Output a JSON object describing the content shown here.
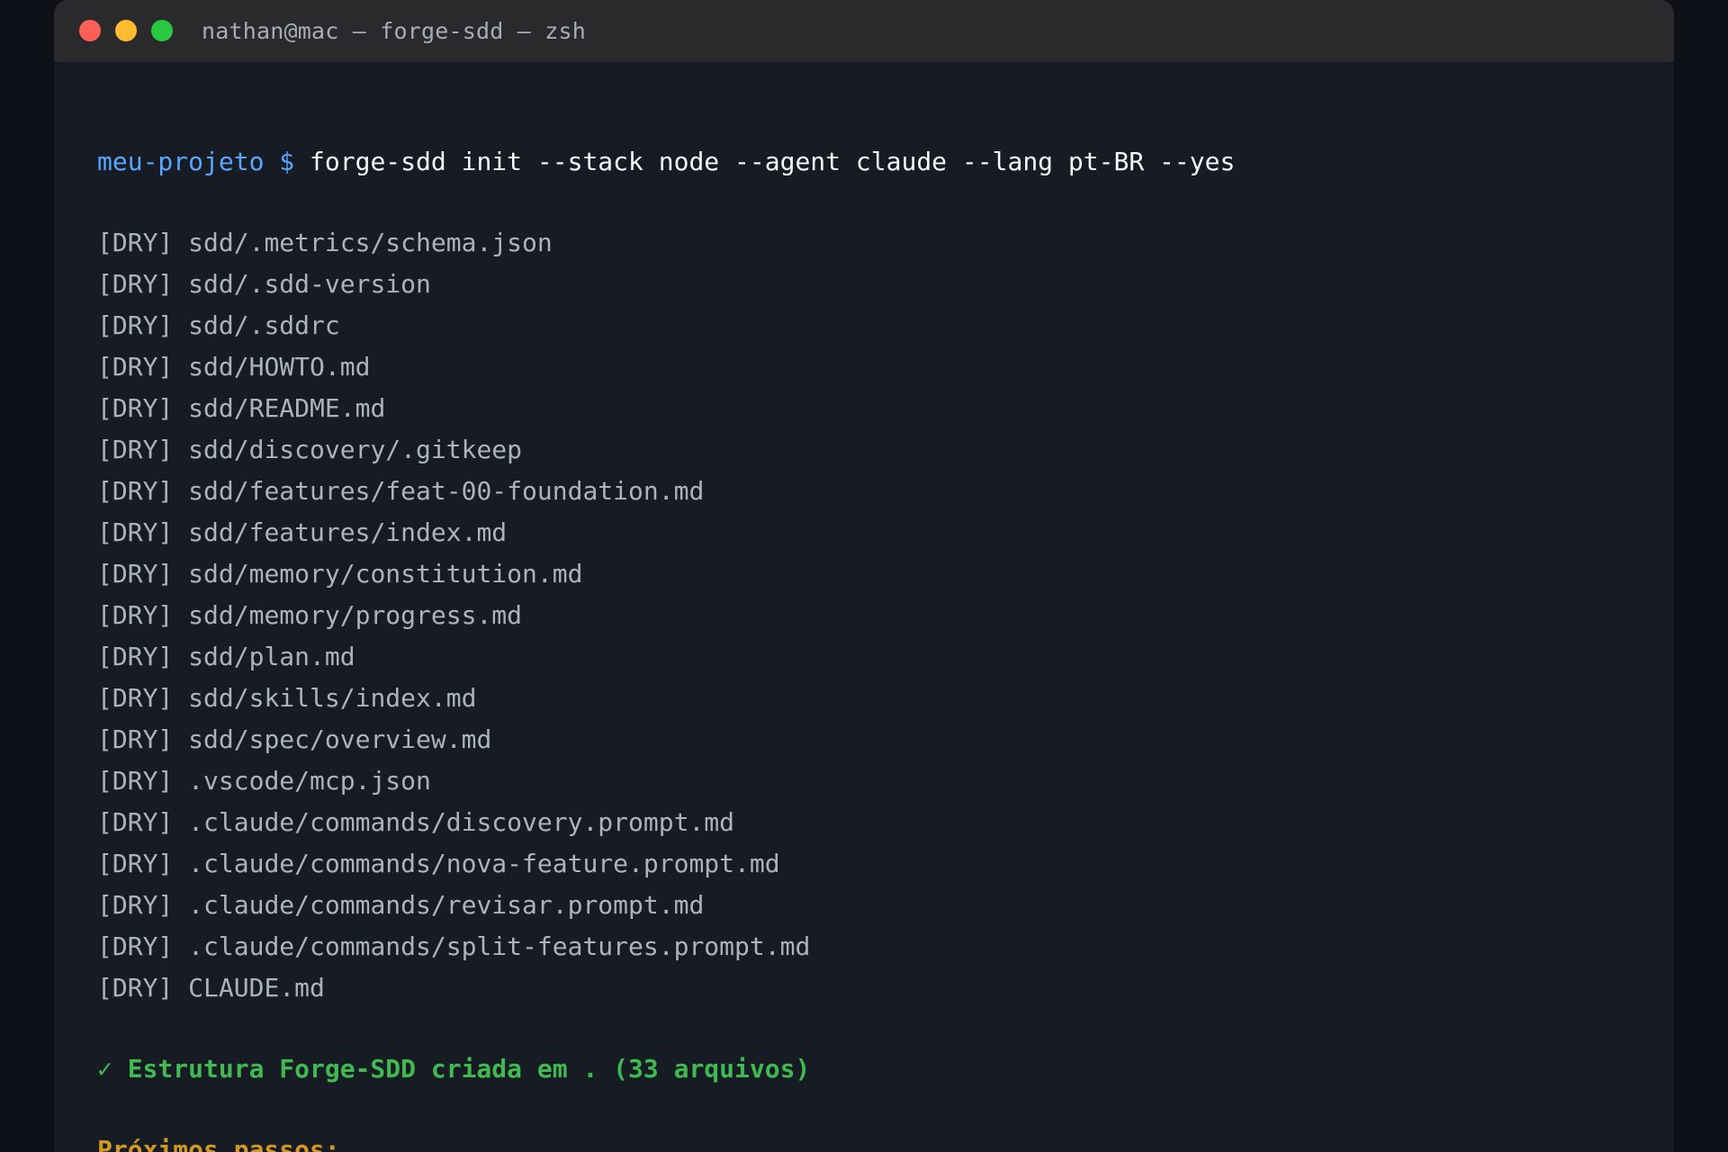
{
  "window": {
    "title": "nathan@mac — forge-sdd — zsh"
  },
  "prompt": {
    "directory": "meu-projeto",
    "symbol": "$",
    "command": "forge-sdd init --stack node --agent claude --lang pt-BR --yes"
  },
  "output": {
    "tag": "[DRY]",
    "files": [
      "sdd/.metrics/schema.json",
      "sdd/.sdd-version",
      "sdd/.sddrc",
      "sdd/HOWTO.md",
      "sdd/README.md",
      "sdd/discovery/.gitkeep",
      "sdd/features/feat-00-foundation.md",
      "sdd/features/index.md",
      "sdd/memory/constitution.md",
      "sdd/memory/progress.md",
      "sdd/plan.md",
      "sdd/skills/index.md",
      "sdd/spec/overview.md",
      ".vscode/mcp.json",
      ".claude/commands/discovery.prompt.md",
      ".claude/commands/nova-feature.prompt.md",
      ".claude/commands/revisar.prompt.md",
      ".claude/commands/split-features.prompt.md",
      "CLAUDE.md"
    ]
  },
  "success": {
    "message": "✓ Estrutura Forge-SDD criada em . (33 arquivos)"
  },
  "next": {
    "label": "Próximos passos:"
  },
  "colors": {
    "prompt": "#58a6ff",
    "success": "#3fb950",
    "next": "#d29922",
    "output": "#adb3bc",
    "background": "#171c24"
  }
}
